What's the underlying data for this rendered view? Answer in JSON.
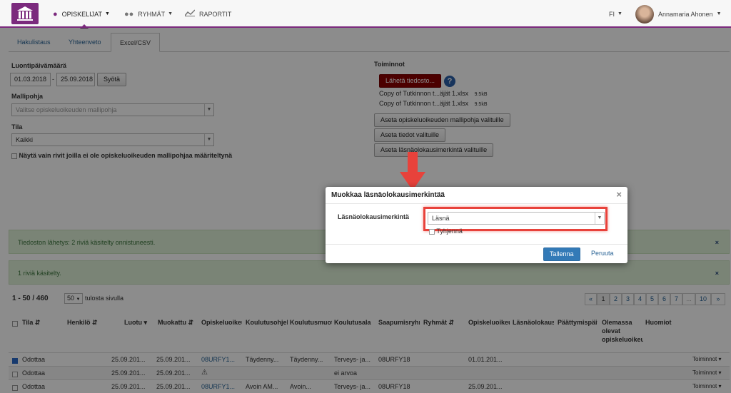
{
  "nav": {
    "students_label": "OPISKELIJAT",
    "groups_label": "RYHMÄT",
    "reports_label": "RAPORTIT",
    "language": "FI",
    "user_name": "Annamaria Ahonen"
  },
  "tabs": [
    "Hakulistaus",
    "Yhteenveto",
    "Excel/CSV"
  ],
  "filters": {
    "creation_date_label": "Luontipäivämäärä",
    "date_from": "01.03.2018",
    "date_separator": "-",
    "date_to": "25.09.2018",
    "submit_label": "Syötä",
    "template_label": "Mallipohja",
    "template_placeholder": "Valitse opiskeluoikeuden mallipohja",
    "state_label": "Tila",
    "state_value": "Kaikki",
    "checkbox_label": "Näytä vain rivit joilla ei ole opiskeluoikeuden mallipohjaa määriteltynä"
  },
  "actions": {
    "title": "Toiminnot",
    "send_file_label": "Lähetä tiedosto...",
    "help_glyph": "?",
    "files": [
      {
        "name": "Copy of Tutkinnon t...äjät 1.xlsx",
        "size": "9.5kB"
      },
      {
        "name": "Copy of Tutkinnon t...äjät 1.xlsx",
        "size": "9.5kB"
      }
    ],
    "set_template_label": "Aseta opiskeluoikeuden mallipohja valituille",
    "set_data_label": "Aseta tiedot valituille",
    "set_presence_label": "Aseta läsnäolokausimerkintä valituille"
  },
  "alerts": [
    {
      "text": "Tiedoston lähetys: 2 riviä käsitelty onnistuneesti.",
      "close": "×"
    },
    {
      "text": "1 riviä käsitelty.",
      "close": "×"
    }
  ],
  "list": {
    "count_label": "1 - 50 / 460",
    "page_size": "50",
    "page_size_suffix": "tulosta sivulla",
    "pagination": [
      "«",
      "1",
      "2",
      "3",
      "4",
      "5",
      "6",
      "7",
      "...",
      "10",
      "»"
    ]
  },
  "table": {
    "headers": [
      "Tila",
      "Henkilö",
      "Luotu",
      "Muokattu",
      "Opiskeluoikeus",
      "Koulutusohjelma",
      "Koulutusmuoto",
      "Koulutusala",
      "Saapumisryhmä",
      "Ryhmät",
      "Opiskeluoikeus",
      "Läsnäolokausi",
      "Päättymispäivä",
      "Olemassa olevat opiskeluoikeudet",
      "Huomiot"
    ],
    "rows": [
      {
        "state": "Odottaa",
        "created": "25.09.201...",
        "modified": "25.09.201...",
        "study_right": "08URFY1...",
        "programme": "Täydenny...",
        "form": "Täydenny...",
        "field": "Terveys- ja...",
        "arrival_group": "08URFY18",
        "right_start": "01.01.201...",
        "actions": "Toiminnot"
      },
      {
        "state": "Odottaa",
        "created": "25.09.201...",
        "modified": "25.09.201...",
        "study_right": "",
        "programme": "",
        "form": "",
        "field": "ei arvoa",
        "arrival_group": "",
        "right_start": "",
        "actions": "Toiminnot"
      },
      {
        "state": "Odottaa",
        "created": "25.09.201...",
        "modified": "25.09.201...",
        "study_right": "08URFY1...",
        "programme": "Avoin AM...",
        "form": "Avoin...",
        "field": "Terveys- ja...",
        "arrival_group": "08URFY18",
        "right_start": "25.09.201...",
        "actions": "Toiminnot"
      }
    ]
  },
  "modal": {
    "title": "Muokkaa läsnäolokausimerkintää",
    "close": "×",
    "field_label": "Läsnäolokausimerkintä",
    "field_value": "Läsnä",
    "clear_label": "Tyhjennä",
    "save_label": "Tallenna",
    "cancel_label": "Peruuta"
  },
  "colors": {
    "brand": "#7b2a7d",
    "primary_button": "#337ab7",
    "danger_button": "#8b0000",
    "highlight": "#e8423b"
  }
}
